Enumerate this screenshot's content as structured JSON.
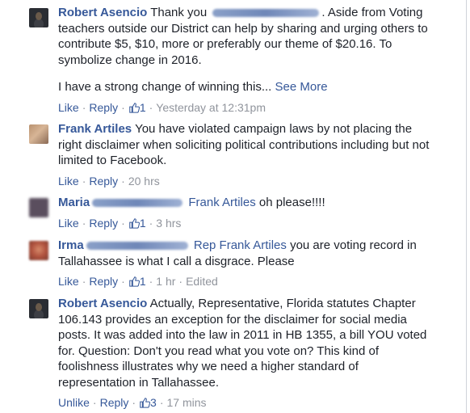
{
  "comments": [
    {
      "author": "Robert Asencio",
      "avatar_icon": "profile-photo",
      "text_parts": {
        "lead": "Thank you",
        "tail": ". Aside from Voting teachers outside our District can help by sharing and urging others to contribute $5, $10, more or preferably our theme of $20.16. To symbolize change in 2016."
      },
      "second_paragraph": "I have a strong change of winning this...",
      "see_more": "See More",
      "actions": {
        "like": "Like",
        "reply": "Reply",
        "likes_count": "1",
        "time": "Yesterday at 12:31pm"
      }
    },
    {
      "author": "Frank Artiles",
      "avatar_icon": "profile-photo",
      "text": "You have violated campaign laws by not placing the right disclaimer when soliciting political contributions including but not limited to Facebook.",
      "actions": {
        "like": "Like",
        "reply": "Reply",
        "time": "20 hrs"
      }
    },
    {
      "author": "Maria",
      "avatar_icon": "profile-photo",
      "mention": "Frank Artiles",
      "text": "oh please!!!!",
      "actions": {
        "like": "Like",
        "reply": "Reply",
        "likes_count": "1",
        "time": "3 hrs"
      }
    },
    {
      "author": "Irma",
      "avatar_icon": "profile-photo",
      "mention": "Rep Frank Artiles",
      "text": "you are voting record in Tallahassee is what I call a disgrace. Please",
      "actions": {
        "like": "Like",
        "reply": "Reply",
        "likes_count": "1",
        "time": "1 hr",
        "edited": "Edited"
      }
    },
    {
      "author": "Robert Asencio",
      "avatar_icon": "profile-photo",
      "text": "Actually, Representative, Florida statutes Chapter 106.143 provides an exception for the disclaimer for social media posts. It was added into the law in 2011 in HB 1355, a bill YOU voted for. Question: Don't you read what you vote on? This kind of foolishness illustrates why we need a higher standard of representation in Tallahassee.",
      "actions": {
        "like": "Unlike",
        "reply": "Reply",
        "likes_count": "3",
        "time": "17 mins"
      }
    }
  ],
  "colors": {
    "link": "#365899",
    "text": "#1d2129",
    "meta": "#90949c"
  }
}
